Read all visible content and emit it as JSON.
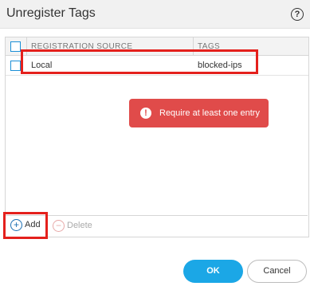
{
  "dialog": {
    "title": "Unregister Tags",
    "help_icon": "?"
  },
  "table": {
    "columns": [
      {
        "label": "REGISTRATION SOURCE"
      },
      {
        "label": "TAGS"
      }
    ],
    "rows": [
      {
        "source": "Local",
        "tags": "blocked-ips",
        "checked": false
      }
    ]
  },
  "error": {
    "icon": "!",
    "message": "Require at least one entry",
    "color": "#e04b4a"
  },
  "toolbar": {
    "add_label": "Add",
    "add_icon": "plus-circle-icon",
    "delete_label": "Delete",
    "delete_icon": "minus-circle-icon"
  },
  "buttons": {
    "ok_label": "OK",
    "cancel_label": "Cancel",
    "accent": "#1ba7e6"
  }
}
